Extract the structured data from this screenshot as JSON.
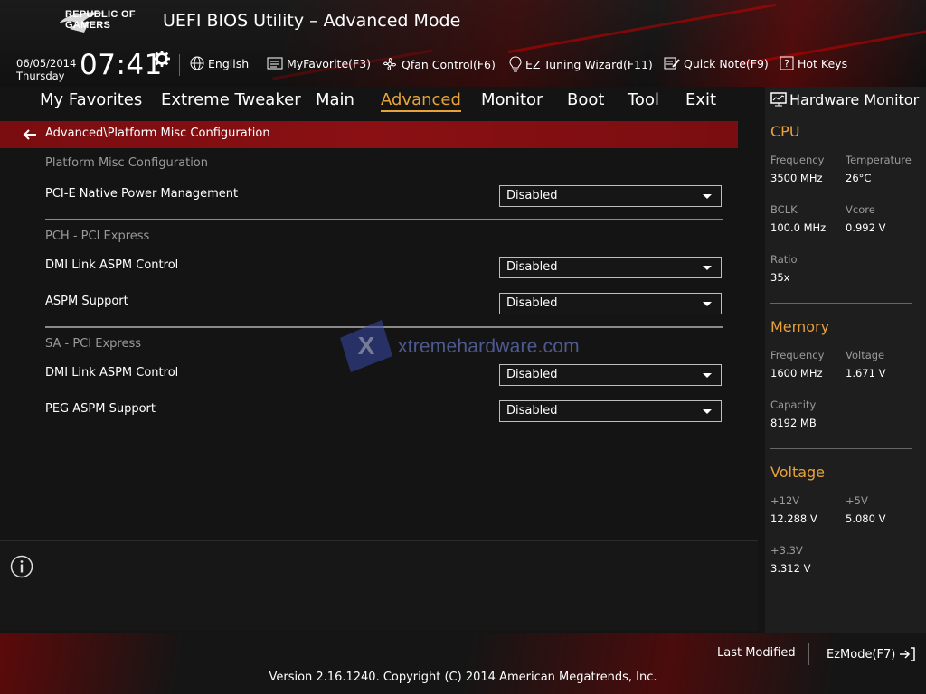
{
  "brand": {
    "line1": "REPUBLIC OF",
    "line2": "GAMERS"
  },
  "app_title": "UEFI BIOS Utility – Advanced Mode",
  "datetime": {
    "date": "06/05/2014",
    "day": "Thursday",
    "time": "07:41"
  },
  "toolbar": {
    "language": "English",
    "myfavorite": "MyFavorite(F3)",
    "qfan": "Qfan Control(F6)",
    "ez_tuning": "EZ Tuning Wizard(F11)",
    "quick_note": "Quick Note(F9)",
    "hot_keys": "Hot Keys"
  },
  "tabs": [
    {
      "label": "My Favorites"
    },
    {
      "label": "Extreme Tweaker"
    },
    {
      "label": "Main"
    },
    {
      "label": "Advanced",
      "active": true
    },
    {
      "label": "Monitor"
    },
    {
      "label": "Boot"
    },
    {
      "label": "Tool"
    },
    {
      "label": "Exit"
    }
  ],
  "breadcrumb": "Advanced\\Platform Misc Configuration",
  "sections": [
    {
      "title": "Platform Misc Configuration",
      "rows": [
        {
          "label": "PCI-E Native Power Management",
          "value": "Disabled"
        }
      ]
    },
    {
      "title": "PCH - PCI Express",
      "rows": [
        {
          "label": "DMI Link ASPM Control",
          "value": "Disabled"
        },
        {
          "label": "ASPM Support",
          "value": "Disabled"
        }
      ]
    },
    {
      "title": "SA - PCI Express",
      "rows": [
        {
          "label": "DMI Link ASPM Control",
          "value": "Disabled"
        },
        {
          "label": "PEG ASPM Support",
          "value": "Disabled"
        }
      ]
    }
  ],
  "watermark": "xtremehardware.com",
  "hardware_monitor": {
    "title": "Hardware Monitor",
    "cpu": {
      "header": "CPU",
      "frequency_label": "Frequency",
      "frequency": "3500 MHz",
      "temperature_label": "Temperature",
      "temperature": "26°C",
      "bclk_label": "BCLK",
      "bclk": "100.0 MHz",
      "vcore_label": "Vcore",
      "vcore": "0.992 V",
      "ratio_label": "Ratio",
      "ratio": "35x"
    },
    "memory": {
      "header": "Memory",
      "frequency_label": "Frequency",
      "frequency": "1600 MHz",
      "voltage_label": "Voltage",
      "voltage": "1.671 V",
      "capacity_label": "Capacity",
      "capacity": "8192 MB"
    },
    "voltage": {
      "header": "Voltage",
      "v12_label": "+12V",
      "v12": "12.288 V",
      "v5_label": "+5V",
      "v5": "5.080 V",
      "v33_label": "+3.3V",
      "v33": "3.312 V"
    }
  },
  "footer": {
    "last_modified": "Last Modified",
    "ezmode": "EzMode(F7)",
    "version": "Version 2.16.1240. Copyright (C) 2014 American Megatrends, Inc."
  },
  "colors": {
    "accent": "#e8a23a",
    "breadcrumb_bg": "#8a1014",
    "panel_bg": "#1e1e1e"
  }
}
